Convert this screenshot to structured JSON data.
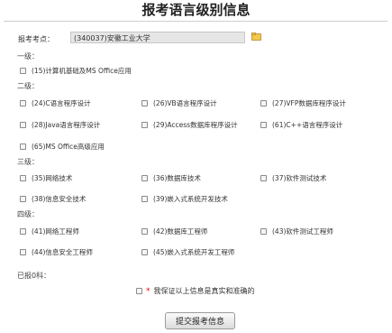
{
  "page": {
    "title": "报考语言级别信息"
  },
  "exam_site": {
    "label": "报考考点：",
    "value": "(340037)安徽工业大学"
  },
  "levels": [
    {
      "name": "一级：",
      "options": [
        "(15)计算机基础及MS Office应用"
      ]
    },
    {
      "name": "二级：",
      "options": [
        "(24)C语言程序设计",
        "(26)VB语言程序设计",
        "(27)VFP数据库程序设计",
        "(28)Java语言程序设计",
        "(29)Access数据库程序设计",
        "(61)C++语言程序设计",
        "(65)MS Office高级应用"
      ]
    },
    {
      "name": "三级：",
      "options": [
        "(35)网络技术",
        "(36)数据库技术",
        "(37)软件测试技术",
        "(38)信息安全技术",
        "(39)嵌入式系统开发技术"
      ]
    },
    {
      "name": "四级：",
      "options": [
        "(41)网络工程师",
        "(42)数据库工程师",
        "(43)软件测试工程师",
        "(44)信息安全工程师",
        "(45)嵌入式系统开发工程师"
      ]
    }
  ],
  "reported_label": "已报0科：",
  "guarantee": {
    "star": "*",
    "text": "我保证以上信息是真实和准确的"
  },
  "submit_label": "提交报考信息"
}
